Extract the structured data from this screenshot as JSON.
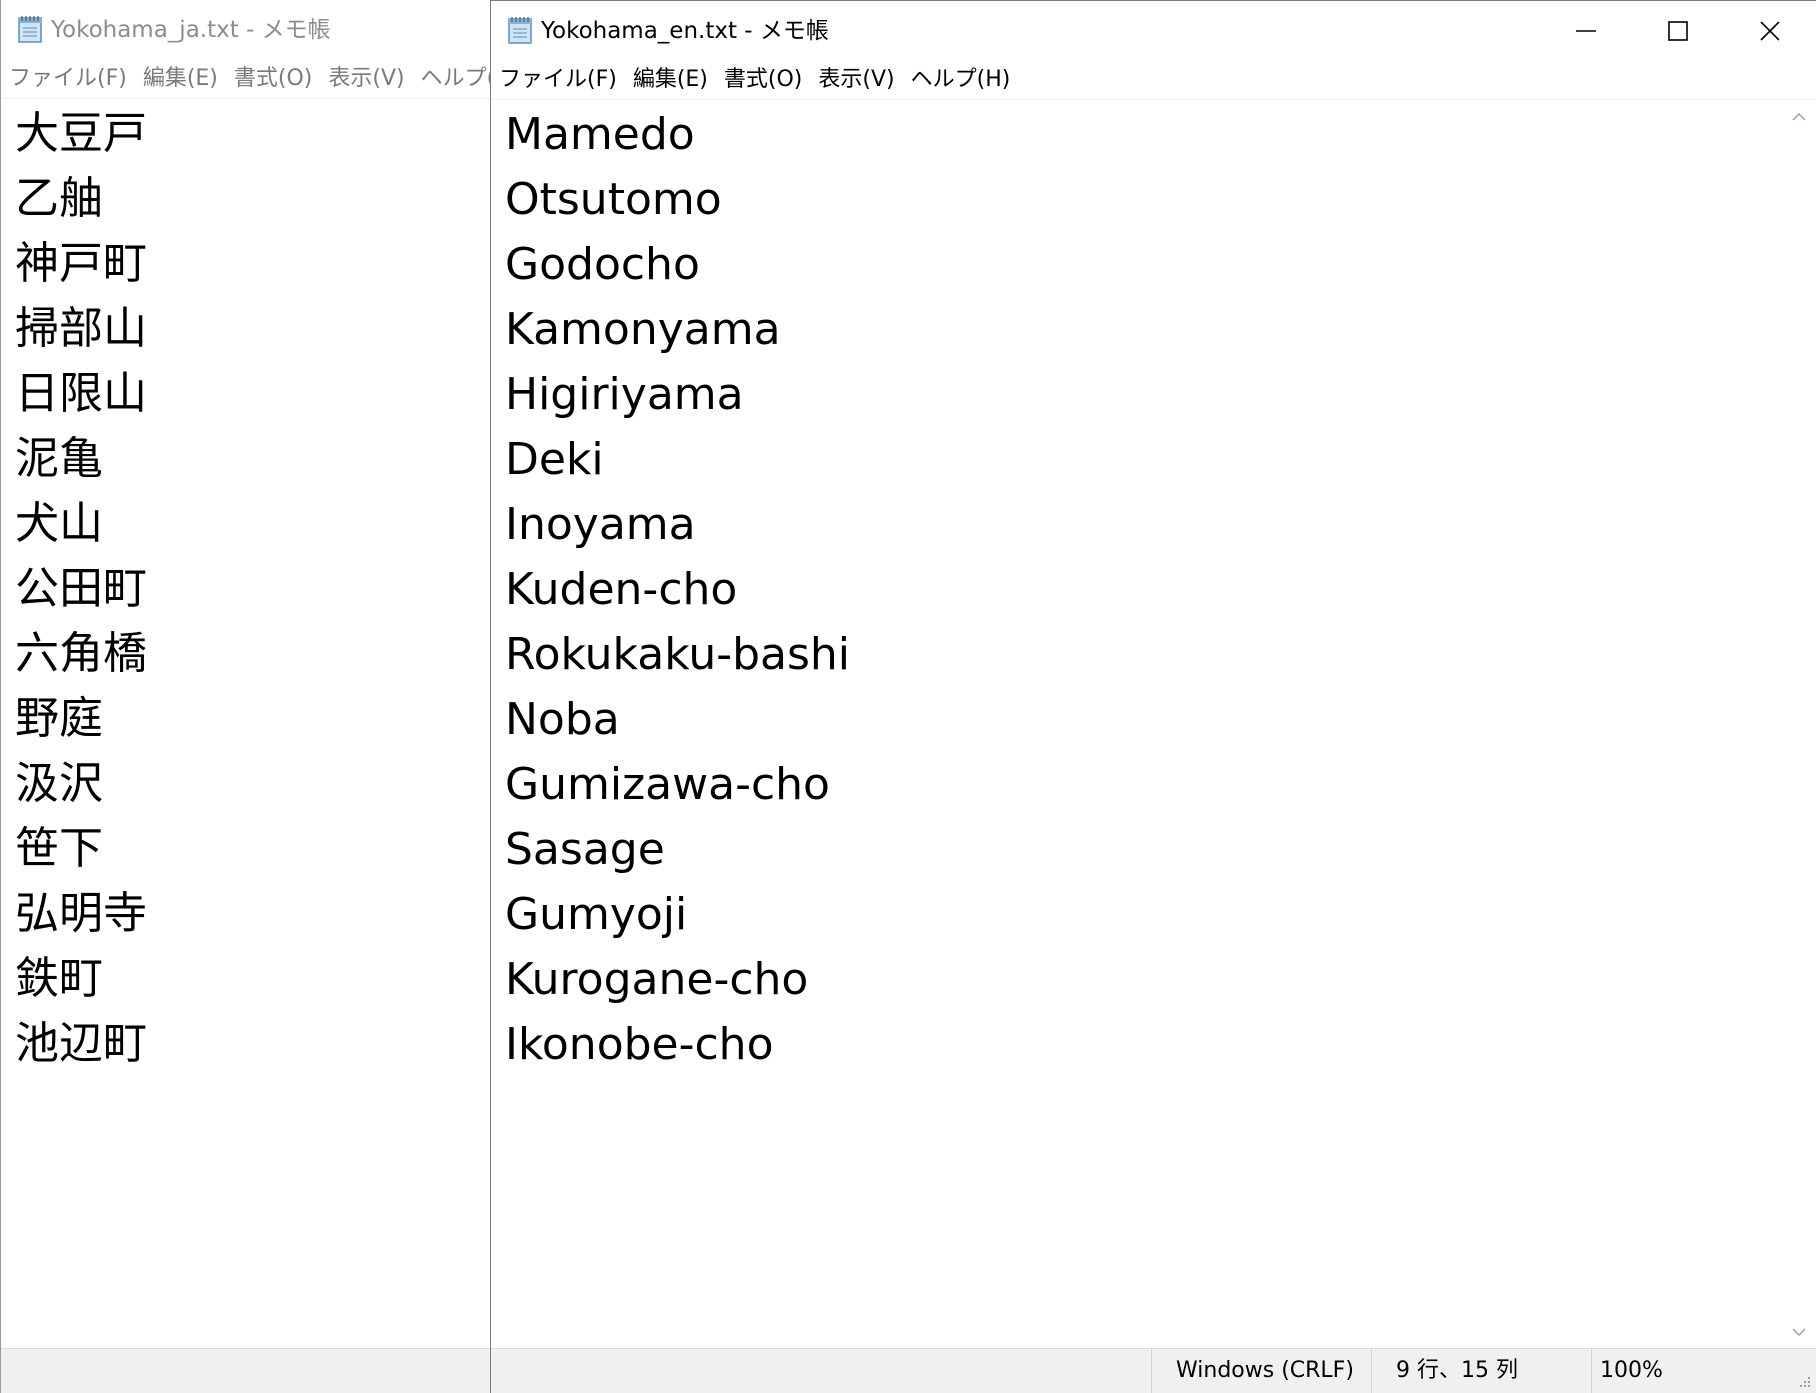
{
  "window_ja": {
    "title": "Yokohama_ja.txt - メモ帳",
    "icon": "notepad-icon",
    "menu": [
      "ファイル(F)",
      "編集(E)",
      "書式(O)",
      "表示(V)",
      "ヘルプ(H)"
    ],
    "lines": [
      "大豆戸",
      "乙舳",
      "神戸町",
      "掃部山",
      "日限山",
      "泥亀",
      "犬山",
      "公田町",
      "六角橋",
      "野庭",
      "汲沢",
      "笹下",
      "弘明寺",
      "鉄町",
      "池辺町"
    ]
  },
  "window_en": {
    "title": "Yokohama_en.txt - メモ帳",
    "icon": "notepad-icon",
    "menu": [
      "ファイル(F)",
      "編集(E)",
      "書式(O)",
      "表示(V)",
      "ヘルプ(H)"
    ],
    "lines": [
      "Mamedo",
      "Otsutomo",
      "Godocho",
      "Kamonyama",
      "Higiriyama",
      "Deki",
      "Inoyama",
      "Kuden-cho",
      "Rokukaku-bashi",
      "Noba",
      "Gumizawa-cho",
      "Sasage",
      "Gumyoji",
      "Kurogane-cho",
      "Ikonobe-cho"
    ],
    "status": {
      "line_ending": "Windows (CRLF)",
      "position": "9 行、15 列",
      "zoom": "100%"
    },
    "caption_icons": [
      "minimize-icon",
      "maximize-icon",
      "close-icon"
    ]
  }
}
